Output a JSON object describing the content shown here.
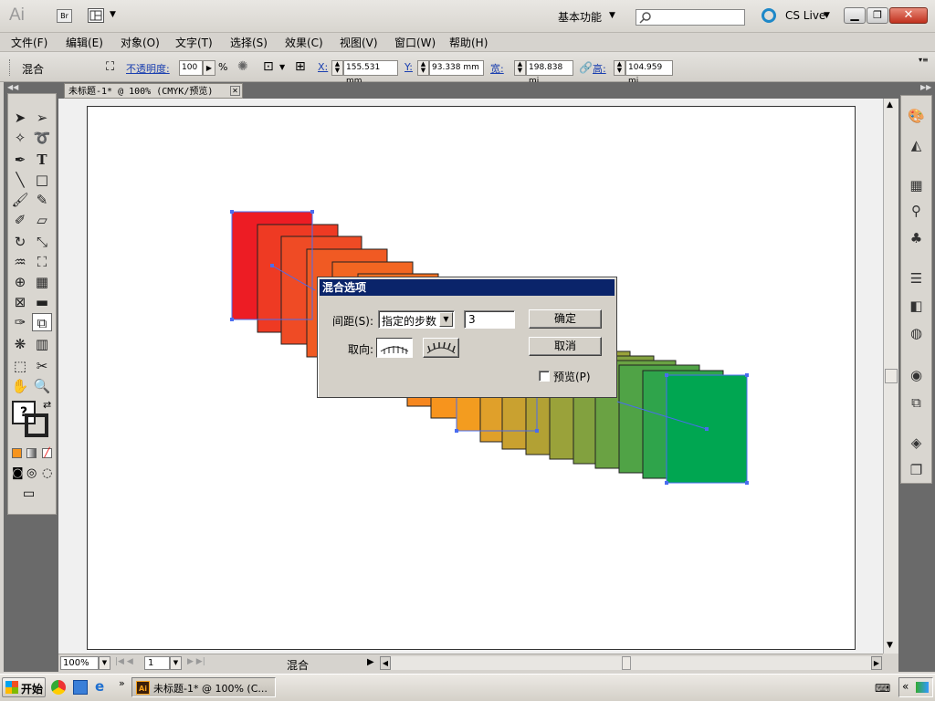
{
  "app": {
    "logo": "Ai",
    "bridge": "Br",
    "workspace": "基本功能",
    "cs_live": "CS Live"
  },
  "menu": [
    "文件(F)",
    "编辑(E)",
    "对象(O)",
    "文字(T)",
    "选择(S)",
    "效果(C)",
    "视图(V)",
    "窗口(W)",
    "帮助(H)"
  ],
  "control": {
    "object_type": "混合",
    "opacity_label": "不透明度:",
    "opacity_value": "100",
    "opacity_unit": "%",
    "x_label": "X:",
    "x_value": "155.531 mm",
    "y_label": "Y:",
    "y_value": "93.338 mm",
    "w_label": "宽:",
    "w_value": "198.838 mi",
    "h_label": "高:",
    "h_value": "104.959 mi"
  },
  "document_tab": {
    "title": "未标题-1* @ 100% (CMYK/预览)"
  },
  "dialog": {
    "title": "混合选项",
    "spacing_label": "间距(S):",
    "spacing_option": "指定的步数",
    "steps_value": "3",
    "orientation_label": "取向:",
    "ok": "确定",
    "cancel": "取消",
    "preview": "预览(P)",
    "preview_checked": false
  },
  "status": {
    "zoom": "100%",
    "page": "1",
    "mode": "混合"
  },
  "taskbar": {
    "start": "开始",
    "task": "未标题-1* @ 100% (C..."
  },
  "colors": {
    "blend_start": "#ed1c24",
    "blend_end": "#00a651",
    "dialog_title": "#0a246a"
  }
}
